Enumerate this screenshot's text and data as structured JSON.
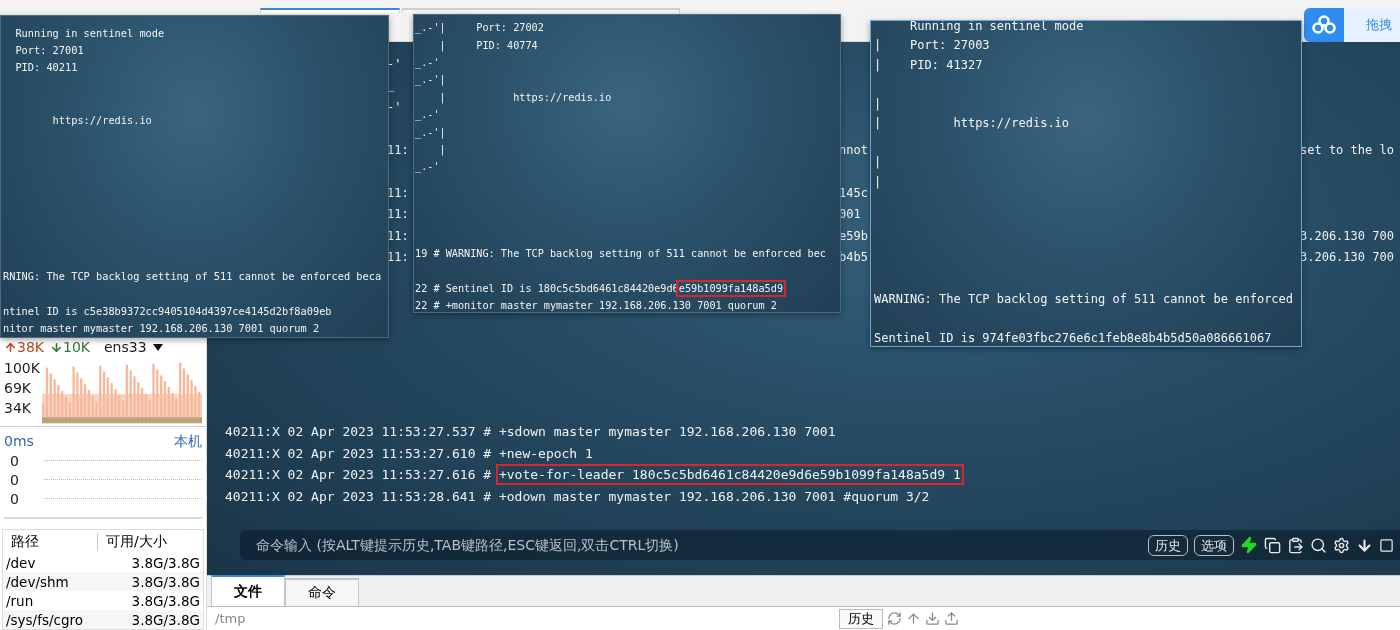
{
  "top_tabs": [
    {
      "selected": true
    },
    {
      "selected": false
    }
  ],
  "cloud_widget": {
    "label": "拖拽"
  },
  "sidebar": {
    "network": {
      "upload": "38K",
      "download": "10K",
      "interface": "ens33",
      "axis_labels": [
        "100K",
        "69K",
        "34K"
      ]
    },
    "ping": {
      "latency": "0ms",
      "target": "本机",
      "values": [
        "0",
        "0",
        "0"
      ]
    },
    "disks": {
      "columns": [
        "路径",
        "可用/大小"
      ],
      "rows": [
        {
          "path": "/dev",
          "usage": "3.8G/3.8G"
        },
        {
          "path": "/dev/shm",
          "usage": "3.8G/3.8G"
        },
        {
          "path": "/run",
          "usage": "3.8G/3.8G"
        },
        {
          "path": "/sys/fs/cgro",
          "usage": "3.8G/3.8G"
        }
      ]
    }
  },
  "terminal": {
    "background_rows": [
      {
        "gap_1": "-'"
      },
      {
        "gap_1": "_"
      },
      {
        "gap_1": "-'"
      },
      {},
      {
        "gap_1": "11:",
        "gap_2": "nnot",
        "right": "set to the lo"
      },
      {},
      {
        "gap_1": "11:",
        "gap_2": "145c"
      },
      {
        "gap_1": "11:",
        "gap_2": "001"
      },
      {
        "gap_1": "11:",
        "gap_2": "e59b",
        "right": "3.206.130 700"
      },
      {
        "gap_1": "11:",
        "gap_2": "b4b5",
        "right": "3.206.130 700"
      }
    ],
    "log_lines": [
      {
        "text": "40211:X 02 Apr 2023 11:53:27.537 # +sdown master mymaster 192.168.206.130 7001"
      },
      {
        "text": "40211:X 02 Apr 2023 11:53:27.610 # +new-epoch 1"
      },
      {
        "text": "40211:X 02 Apr 2023 11:53:27.616 # ",
        "marked": "+vote-for-leader 180c5c5bd6461c84420e9d6e59b1099fa148a5d9 1"
      },
      {
        "text": "40211:X 02 Apr 2023 11:53:28.641 # +odown master mymaster 192.168.206.130 7001 #quorum 3/2"
      }
    ],
    "command_input": {
      "placeholder": "命令输入 (按ALT键提示历史,TAB键路径,ESC键返回,双击CTRL切换)"
    },
    "buttons": [
      "历史",
      "选项"
    ]
  },
  "sentinel_windows": [
    {
      "lines": [
        {
          "kind": "text",
          "text": "  Running in sentinel mode"
        },
        {
          "kind": "text",
          "text": "  Port: 27001"
        },
        {
          "kind": "text",
          "text": "  PID: 40211"
        },
        {
          "kind": "blank"
        },
        {
          "kind": "blank"
        },
        {
          "kind": "text",
          "text": "        https://redis.io"
        },
        {
          "kind": "blank"
        },
        {
          "kind": "blank"
        },
        {
          "kind": "blank"
        },
        {
          "kind": "blank"
        },
        {
          "kind": "blank"
        },
        {
          "kind": "blank"
        },
        {
          "kind": "blank"
        },
        {
          "kind": "blank"
        },
        {
          "kind": "text",
          "text": "RNING: The TCP backlog setting of 511 cannot be enforced beca"
        },
        {
          "kind": "blank"
        },
        {
          "kind": "text",
          "text": "ntinel ID is c5e38b9372cc9405104d4397ce4145d2bf8a09eb"
        },
        {
          "kind": "text",
          "text": "nitor master mymaster 192.168.206.130 7001 quorum 2"
        }
      ]
    },
    {
      "lines": [
        {
          "kind": "text",
          "text": "_.-'|     Port: 27002"
        },
        {
          "kind": "text",
          "text": "    |     PID: 40774"
        },
        {
          "kind": "text",
          "text": "_.-'"
        },
        {
          "kind": "text",
          "text": "_.-'|"
        },
        {
          "kind": "text",
          "text": "    |           https://redis.io"
        },
        {
          "kind": "text",
          "text": "_.-'"
        },
        {
          "kind": "text",
          "text": "_.-'|"
        },
        {
          "kind": "text",
          "text": "    |"
        },
        {
          "kind": "text",
          "text": "_.-'"
        },
        {
          "kind": "blank"
        },
        {
          "kind": "blank"
        },
        {
          "kind": "blank"
        },
        {
          "kind": "blank"
        },
        {
          "kind": "text",
          "text": "19 # WARNING: The TCP backlog setting of 511 cannot be enforced bec"
        },
        {
          "kind": "blank"
        },
        {
          "kind": "text",
          "text": "22 # Sentinel ID is 180c5c5bd6461c84420e9d6",
          "marked": "e59b1099fa148a5d9"
        },
        {
          "kind": "text",
          "text": "22 # +monitor master mymaster 192.168.206.130 7001 quorum 2"
        }
      ]
    },
    {
      "lines": [
        {
          "kind": "text",
          "text": "     Running in sentinel mode"
        },
        {
          "kind": "text",
          "text": "|    Port: 27003"
        },
        {
          "kind": "text",
          "text": "|    PID: 41327"
        },
        {
          "kind": "blank"
        },
        {
          "kind": "text",
          "text": "|"
        },
        {
          "kind": "text",
          "text": "|          https://redis.io"
        },
        {
          "kind": "blank"
        },
        {
          "kind": "text",
          "text": "|"
        },
        {
          "kind": "text",
          "text": "|"
        },
        {
          "kind": "blank"
        },
        {
          "kind": "blank"
        },
        {
          "kind": "blank"
        },
        {
          "kind": "blank"
        },
        {
          "kind": "blank"
        },
        {
          "kind": "text",
          "text": "WARNING: The TCP backlog setting of 511 cannot be enforced"
        },
        {
          "kind": "blank"
        },
        {
          "kind": "text",
          "text": "Sentinel ID is 974fe03fbc276e6c1feb8e8b4b5d50a086661067"
        }
      ]
    }
  ],
  "bottom_panel": {
    "tabs": [
      {
        "label": "文件",
        "selected": true
      },
      {
        "label": "命令",
        "selected": false
      }
    ],
    "path": "/tmp",
    "history_button": "历史"
  }
}
